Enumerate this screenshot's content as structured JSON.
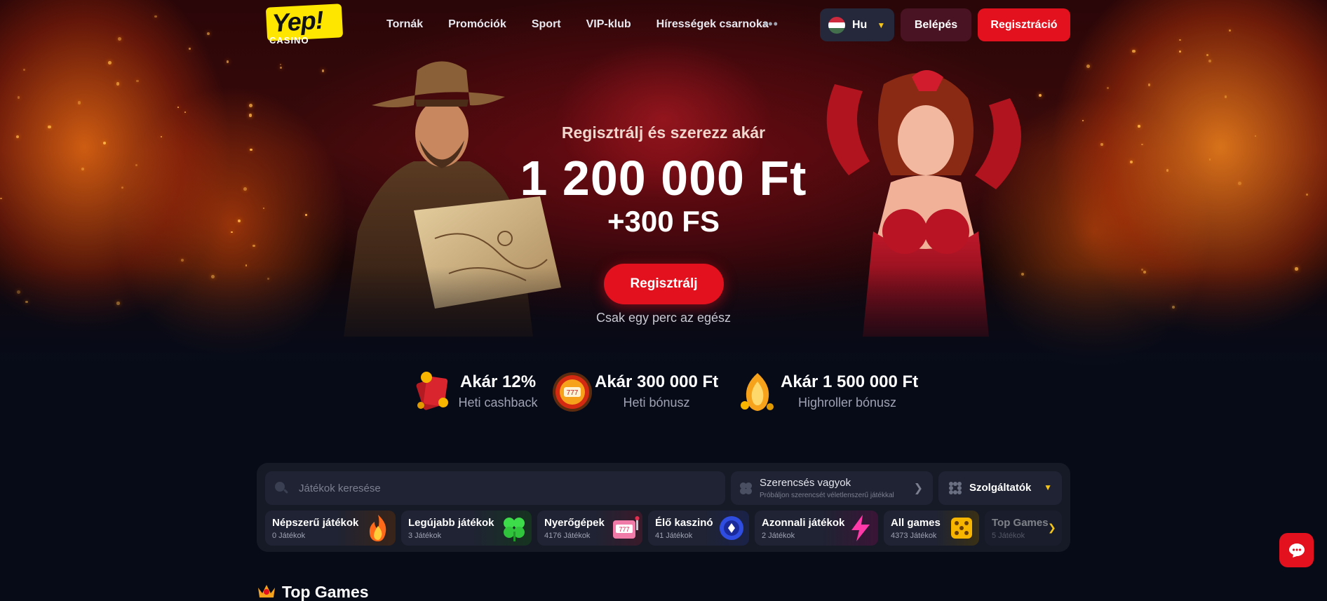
{
  "header": {
    "logo": {
      "main": "Yep!",
      "sub": "CASINO"
    },
    "nav": [
      "Tornák",
      "Promóciók",
      "Sport",
      "VIP-klub",
      "Hírességek csarnoka"
    ],
    "more_label": "•••",
    "language": {
      "label": "Hu",
      "flag_colors": [
        "#cd2a3e",
        "#ffffff",
        "#436f4d"
      ]
    },
    "login_label": "Belépés",
    "register_label": "Regisztráció"
  },
  "hero": {
    "subtitle": "Regisztrálj és szerezz akár",
    "amount": "1 200 000 Ft",
    "free_spins": "+300 FS",
    "cta_label": "Regisztrálj",
    "note": "Csak egy perc az egész"
  },
  "perks": [
    {
      "title": "Akár 12%",
      "desc": "Heti cashback",
      "icon": "cashback-icon"
    },
    {
      "title": "Akár 300 000 Ft",
      "desc": "Heti bónusz",
      "icon": "bonus-wheel-icon"
    },
    {
      "title": "Akár 1 500 000 Ft",
      "desc": "Highroller bónusz",
      "icon": "highroller-icon"
    }
  ],
  "games_panel": {
    "search_placeholder": "Játékok keresése",
    "lucky": {
      "title": "Szerencsés vagyok",
      "desc": "Próbáljon szerencsét véletlenszerű játékkal"
    },
    "providers_label": "Szolgáltatók",
    "categories": [
      {
        "name": "Népszerű játékok",
        "count": "0 Játékok",
        "icon": "fire-icon"
      },
      {
        "name": "Legújabb játékok",
        "count": "3 Játékok",
        "icon": "clover-icon"
      },
      {
        "name": "Nyerőgépek",
        "count": "4176 Játékok",
        "icon": "slot-machine-icon"
      },
      {
        "name": "Élő kaszinó",
        "count": "41 Játékok",
        "icon": "casino-chip-icon"
      },
      {
        "name": "Azonnali játékok",
        "count": "2 Játékok",
        "icon": "lightning-icon"
      },
      {
        "name": "All games",
        "count": "4373 Játékok",
        "icon": "dice-icon"
      },
      {
        "name": "Top Games",
        "count": "5 Játékok",
        "icon": "crown-icon"
      }
    ]
  },
  "top_games": {
    "title": "Top Games"
  },
  "colors": {
    "accent_red": "#e3101e",
    "gold": "#f5c518",
    "panel": "#161a27"
  }
}
